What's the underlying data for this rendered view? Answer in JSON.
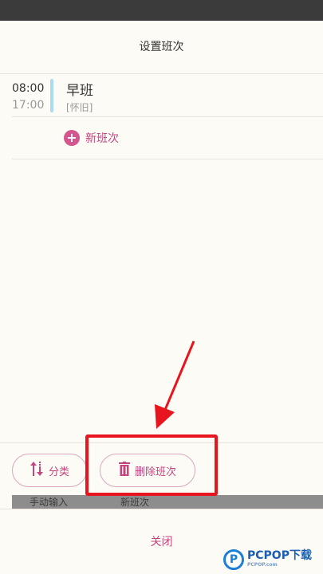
{
  "header": {
    "title": "设置班次"
  },
  "shifts": [
    {
      "start": "08:00",
      "end": "17:00",
      "name": "早班",
      "note": "[怀旧]",
      "color": "#a9dcee"
    }
  ],
  "new_shift": {
    "label": "新班次"
  },
  "underlying": {
    "manual_input": "手动输入",
    "new_shift": "新班次"
  },
  "actions": {
    "sort_label": "分类",
    "delete_label": "删除班次"
  },
  "close": {
    "label": "关闭"
  },
  "watermark": {
    "main": "PCPOP下载",
    "sub": "PCPOP.com"
  },
  "colors": {
    "accent": "#c4467e",
    "highlight": "#e8141e",
    "shift_bar": "#a9dcee"
  },
  "icons": {
    "plus": "plus-circle-icon",
    "sort": "sort-arrows-icon",
    "delete": "trash-icon"
  }
}
